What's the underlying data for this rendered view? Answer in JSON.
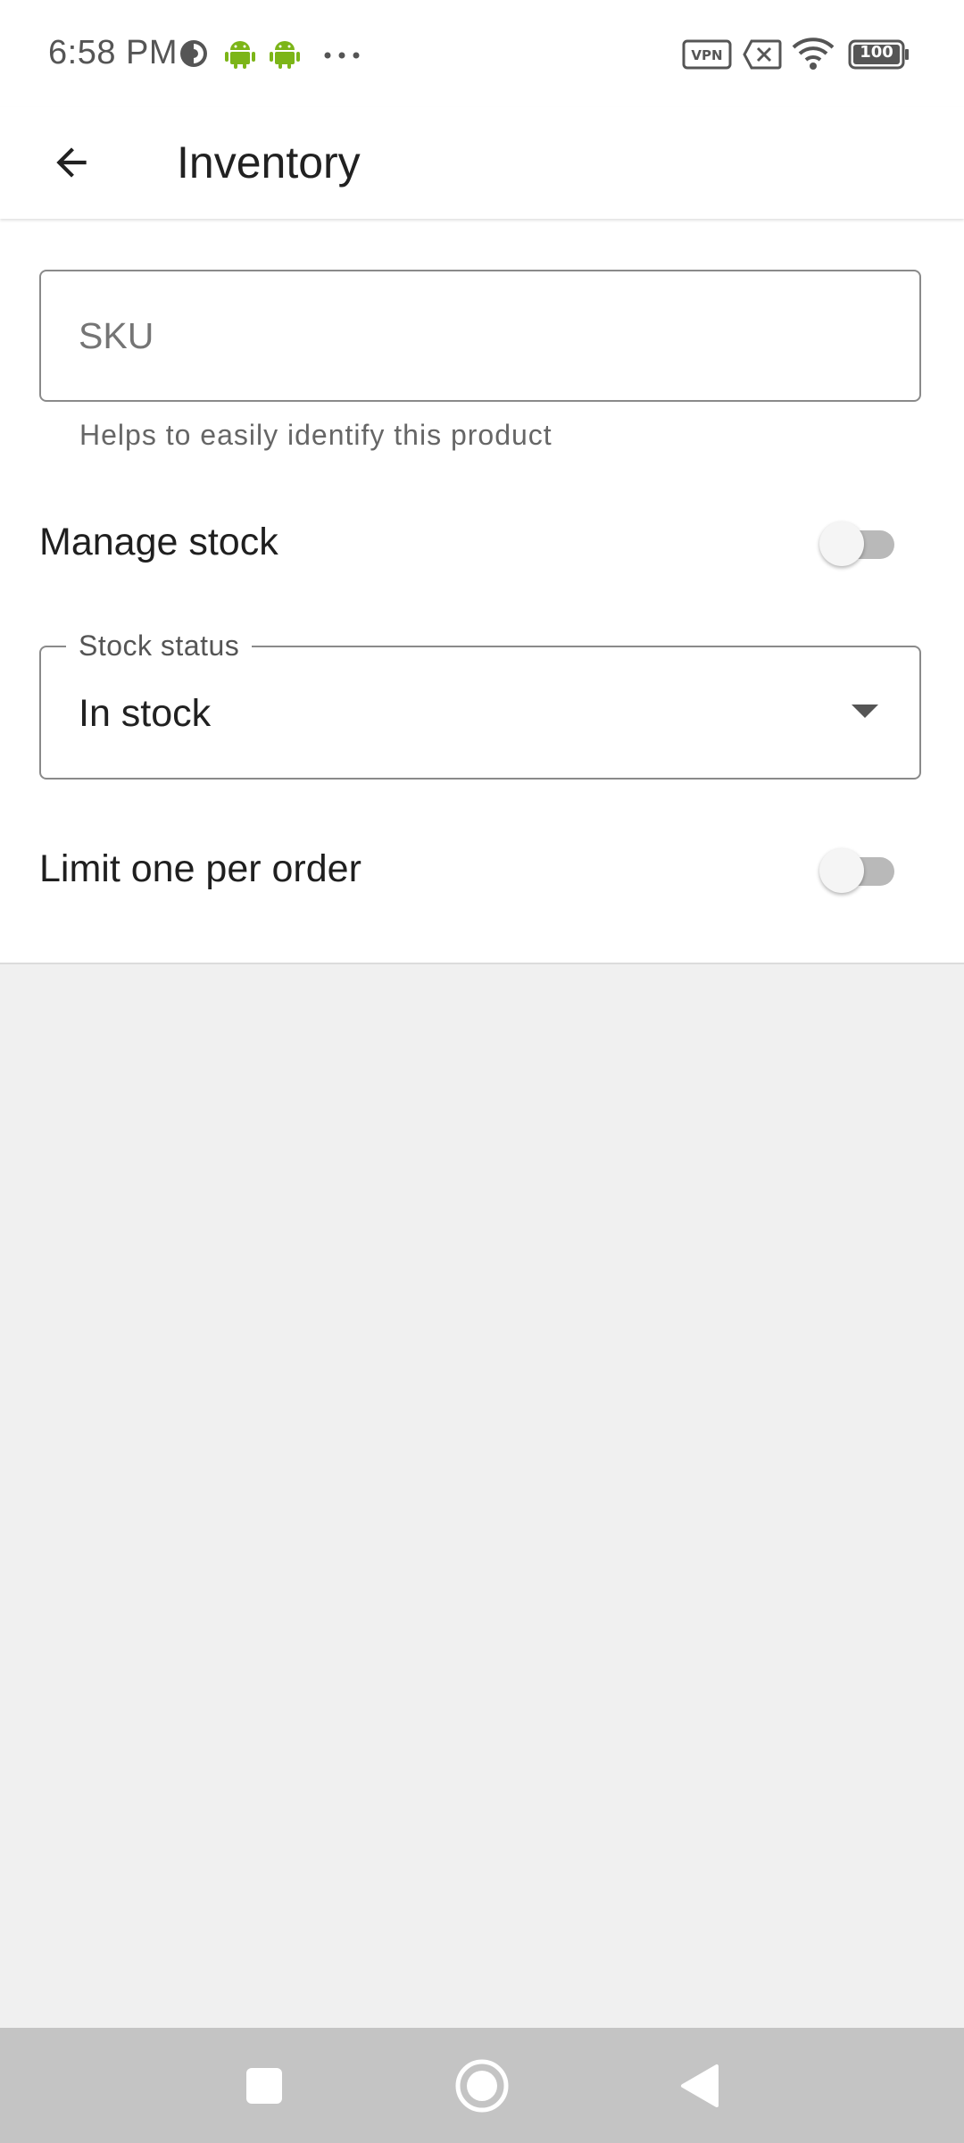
{
  "status_bar": {
    "time": "6:58 PM",
    "battery_level": "100",
    "icons": [
      "data-saver-icon",
      "android-icon",
      "android-icon",
      "more-dots-icon",
      "vpn-icon",
      "no-sim-icon",
      "wifi-icon",
      "battery-icon"
    ]
  },
  "app_bar": {
    "title": "Inventory"
  },
  "form": {
    "sku": {
      "placeholder": "SKU",
      "value": "",
      "helper": "Helps to easily identify this product"
    },
    "manage_stock": {
      "label": "Manage stock",
      "enabled": false
    },
    "stock_status": {
      "label": "Stock status",
      "value": "In stock"
    },
    "limit_one": {
      "label": "Limit one per order",
      "enabled": false
    }
  },
  "colors": {
    "android_green": "#7cb518",
    "nav_bar": "#c4c4c4",
    "background": "#f0f0f0"
  }
}
